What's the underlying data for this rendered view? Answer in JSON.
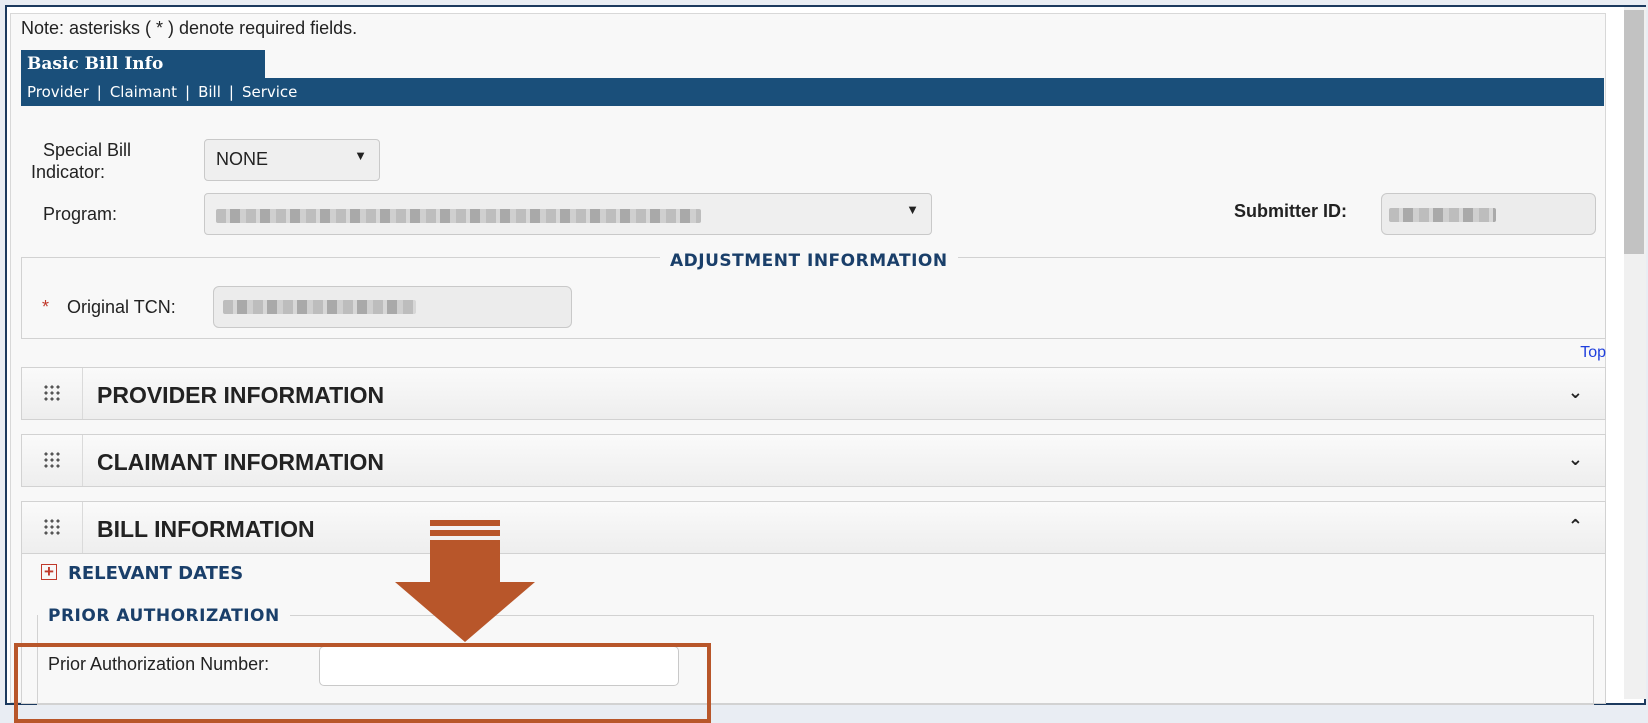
{
  "note": "Note: asterisks ( * ) denote required fields.",
  "tab": {
    "label": "Basic Bill Info"
  },
  "nav": {
    "items": [
      "Provider",
      "Claimant",
      "Bill",
      "Service"
    ]
  },
  "special_bill": {
    "label_line1": "Special Bill",
    "label_line2": "Indicator:",
    "value": "NONE"
  },
  "program": {
    "label": "Program:"
  },
  "submitter": {
    "label": "Submitter ID:"
  },
  "adjustment": {
    "legend": "ADJUSTMENT INFORMATION",
    "required_mark": "*",
    "tcn_label": "Original TCN:"
  },
  "top_link": "Top",
  "sections": {
    "provider": "PROVIDER INFORMATION",
    "claimant": "CLAIMANT INFORMATION",
    "bill": "BILL INFORMATION"
  },
  "icons": {
    "grid": "grid-icon",
    "chevron_down": "chevron-down-icon",
    "chevron_up": "chevron-up-icon",
    "plus": "plus-icon"
  },
  "relevant_dates": "RELEVANT DATES",
  "prior_auth": {
    "legend": "PRIOR AUTHORIZATION",
    "number_label": "Prior Authorization Number:",
    "number_value": ""
  },
  "colors": {
    "header_blue": "#1a4f7a",
    "legend_blue": "#1a3f6a",
    "highlight": "#b8562a",
    "required_red": "#c0392b"
  }
}
